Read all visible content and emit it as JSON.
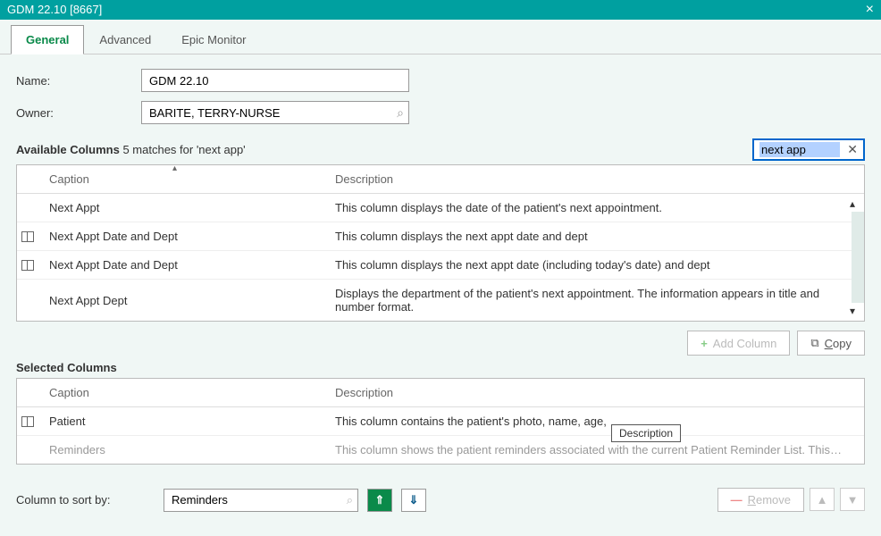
{
  "window": {
    "title": "GDM 22.10 [8667]"
  },
  "tabs": {
    "general": "General",
    "advanced": "Advanced",
    "epic": "Epic Monitor"
  },
  "form": {
    "name_label": "Name:",
    "name_value": "GDM 22.10",
    "owner_label": "Owner:",
    "owner_value": "BARITE, TERRY-NURSE"
  },
  "available": {
    "title": "Available Columns",
    "subtitle": "5 matches for 'next app'",
    "search_value": "next app",
    "headers": {
      "caption": "Caption",
      "description": "Description"
    },
    "rows": [
      {
        "caption": "Next Appt",
        "desc": "This column displays the date of the patient's next appointment.",
        "icon": false
      },
      {
        "caption": "Next Appt Date and Dept",
        "desc": "This column displays the next appt date and dept",
        "icon": true
      },
      {
        "caption": "Next Appt Date and Dept",
        "desc": "This column displays the next appt date (including today's date) and dept",
        "icon": true
      },
      {
        "caption": "Next Appt Dept",
        "desc": "Displays the department of the patient's next appointment. The information appears in title and number format.",
        "icon": false
      }
    ]
  },
  "buttons": {
    "add": "Add Column",
    "copy": "Copy",
    "remove": "Remove"
  },
  "selected": {
    "title": "Selected Columns",
    "headers": {
      "caption": "Caption",
      "description": "Description"
    },
    "rows": [
      {
        "caption": "Patient",
        "desc": "This column contains the patient's photo, name, age, ",
        "icon": true,
        "muted": false
      },
      {
        "caption": "Reminders",
        "desc": "This column shows the patient reminders associated with the current Patient Reminder List. This…",
        "icon": false,
        "muted": true
      }
    ],
    "tooltip": "Description"
  },
  "sort": {
    "label": "Column to sort by:",
    "value": "Reminders"
  }
}
